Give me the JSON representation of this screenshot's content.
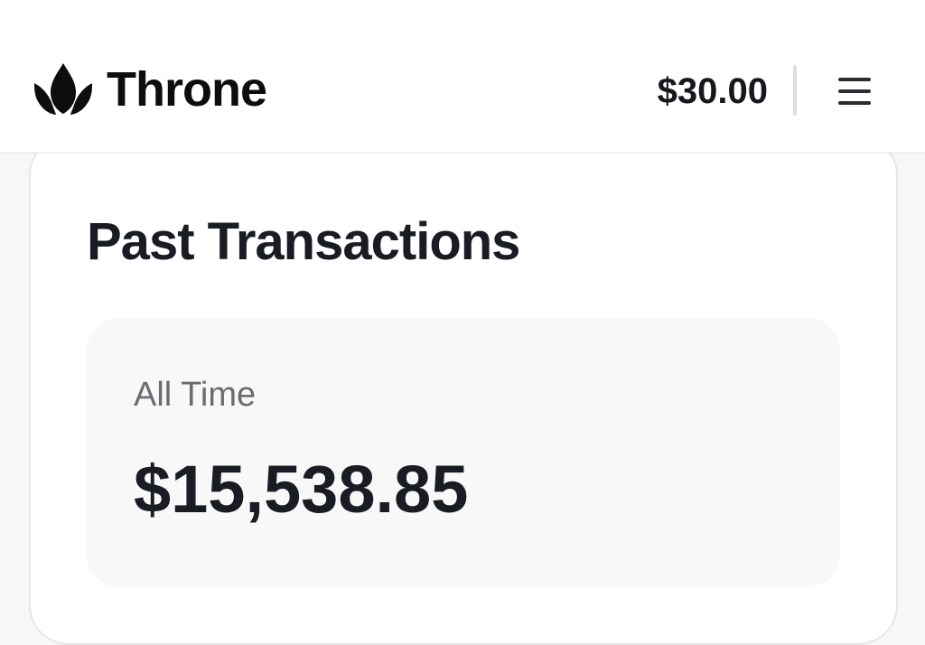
{
  "header": {
    "brand": "Throne",
    "logo_icon": "throne-crown-icon",
    "balance": "$30.00",
    "menu_icon": "hamburger-menu-icon"
  },
  "card": {
    "title": "Past Transactions",
    "stat": {
      "label": "All Time",
      "value": "$15,538.85"
    }
  },
  "colors": {
    "page_bg": "#f7f7f8",
    "header_bg": "#ffffff",
    "text_primary": "#16181d",
    "text_muted": "#6a6c72",
    "stat_box_bg": "#f8f8f9"
  }
}
